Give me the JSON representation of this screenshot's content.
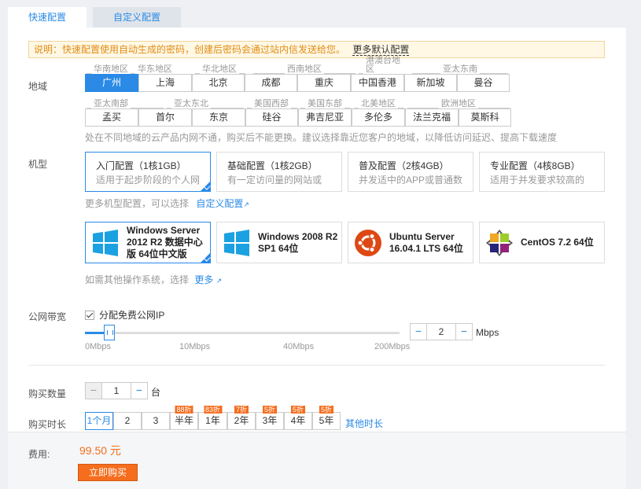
{
  "tabs": [
    {
      "label": "快速配置"
    },
    {
      "label": "自定义配置"
    }
  ],
  "notice": {
    "text": "说明：快速配置使用自动生成的密码，创建后密码会通过站内信发送给您。",
    "link": "更多默认配置"
  },
  "region": {
    "label": "地域",
    "row1_groups": [
      "华南地区",
      "华东地区",
      "华北地区",
      "西南地区",
      "港澳台地区",
      "亚太东南"
    ],
    "row1": [
      "广州",
      "上海",
      "北京",
      "成都",
      "重庆",
      "中国香港",
      "新加坡",
      "曼谷"
    ],
    "row2_groups": [
      "亚太南部",
      "亚太东北",
      "美国西部",
      "美国东部",
      "北美地区",
      "欧洲地区"
    ],
    "row2": [
      "孟买",
      "首尔",
      "东京",
      "硅谷",
      "弗吉尼亚",
      "多伦多",
      "法兰克福",
      "莫斯科"
    ],
    "hint": "处在不同地域的云产品内网不通，购买后不能更换。建议选择靠近您客户的地域，以降低访问延迟、提高下载速度"
  },
  "model": {
    "label": "机型",
    "cards": [
      {
        "title": "入门配置（1核1GB）",
        "desc": "适用于起步阶段的个人网"
      },
      {
        "title": "基础配置（1核2GB）",
        "desc": "有一定访问量的网站或"
      },
      {
        "title": "普及配置（2核4GB）",
        "desc": "并发适中的APP或普通数"
      },
      {
        "title": "专业配置（4核8GB）",
        "desc": "适用于并发要求较高的"
      }
    ],
    "more_hint": "更多机型配置，可以选择",
    "more_link": "自定义配置"
  },
  "os": {
    "items": [
      {
        "name": "Windows Server 2012 R2 数据中心版 64位中文版",
        "icon": "windows-icon"
      },
      {
        "name": "Windows 2008 R2 SP1 64位",
        "icon": "windows-icon"
      },
      {
        "name": "Ubuntu Server 16.04.1 LTS 64位",
        "icon": "ubuntu-icon"
      },
      {
        "name": "CentOS 7.2 64位",
        "icon": "centos-icon"
      }
    ],
    "more_hint": "如需其他操作系统，选择",
    "more_link": "更多"
  },
  "bandwidth": {
    "label": "公网带宽",
    "checkbox_label": "分配免费公网IP",
    "checked": true,
    "ticks": [
      "0Mbps",
      "10Mbps",
      "40Mbps",
      "200Mbps"
    ],
    "value": "2",
    "unit": "Mbps",
    "minus": "−",
    "plus": "−"
  },
  "quantity": {
    "label": "购买数量",
    "value": "1",
    "unit": "台",
    "minus": "−",
    "plus": "−"
  },
  "duration": {
    "label": "购买时长",
    "options": [
      {
        "label": "1个月",
        "badge": ""
      },
      {
        "label": "2",
        "badge": ""
      },
      {
        "label": "3",
        "badge": ""
      },
      {
        "label": "半年",
        "badge": "88折"
      },
      {
        "label": "1年",
        "badge": "83折"
      },
      {
        "label": "2年",
        "badge": "7折"
      },
      {
        "label": "3年",
        "badge": "5折"
      },
      {
        "label": "4年",
        "badge": "5折"
      },
      {
        "label": "5年",
        "badge": "5折"
      }
    ],
    "other": "其他时长"
  },
  "footer": {
    "fee_label": "费用:",
    "price": "99.50 元",
    "buy": "立即购买"
  },
  "colors": {
    "accent": "#2a8ae6",
    "orange": "#f56d1d"
  }
}
